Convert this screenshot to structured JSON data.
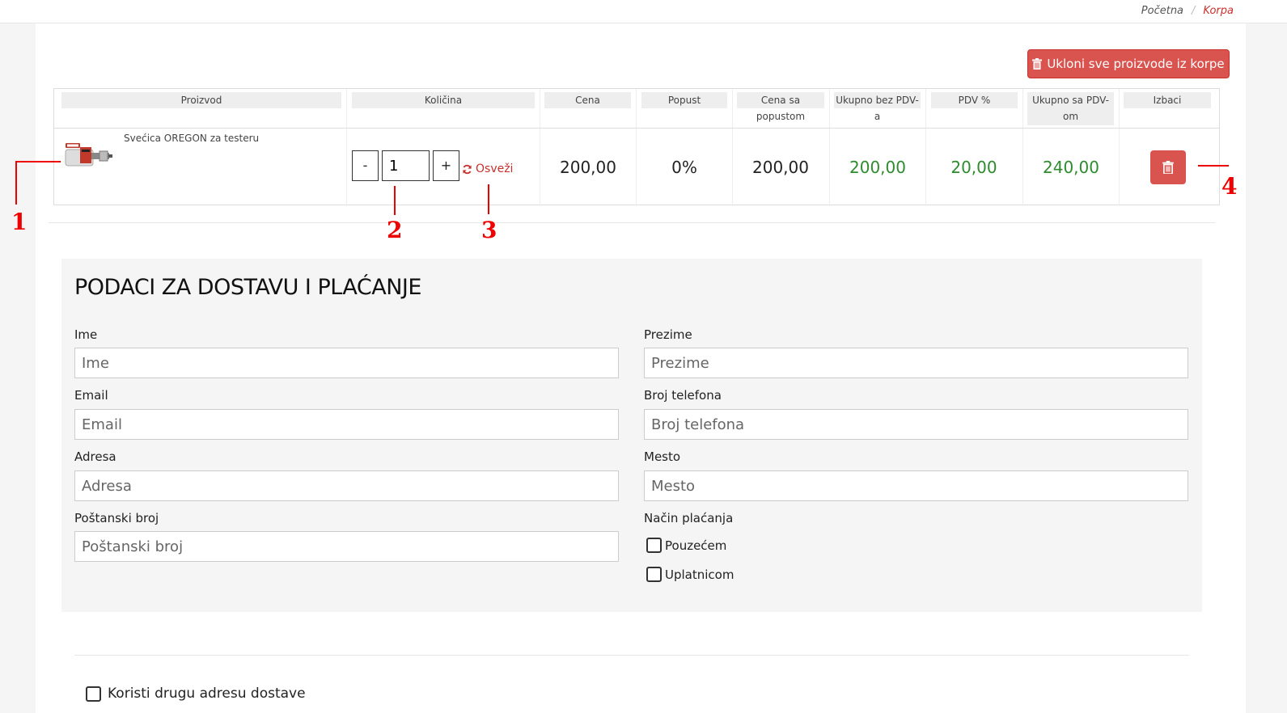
{
  "breadcrumb": {
    "home": "Početna",
    "separator": "/",
    "current": "Korpa"
  },
  "cart": {
    "clear_button_label": "Ukloni sve proizvode iz korpe",
    "headers": {
      "product": "Proizvod",
      "quantity": "Količina",
      "price": "Cena",
      "discount": "Popust",
      "discounted_price": "Cena sa popustom",
      "total_without_vat": "Ukupno bez PDV-a",
      "vat_percent": "PDV %",
      "total_with_vat_line1": "Ukupno sa PDV-",
      "total_with_vat_line2": "om",
      "remove": "Izbaci"
    },
    "items": [
      {
        "name": "Svećica OREGON za testeru",
        "quantity": "1",
        "minus": "-",
        "plus": "+",
        "refresh": "Osveži",
        "price": "200,00",
        "discount": "0%",
        "discounted_price": "200,00",
        "total_without_vat": "200,00",
        "vat": "20,00",
        "total_with_vat": "240,00"
      }
    ]
  },
  "form": {
    "title": "PODACI ZA DOSTAVU I PLAĆANJE",
    "first_name": {
      "label": "Ime",
      "placeholder": "Ime"
    },
    "last_name": {
      "label": "Prezime",
      "placeholder": "Prezime"
    },
    "email": {
      "label": "Email",
      "placeholder": "Email"
    },
    "phone": {
      "label": "Broj telefona",
      "placeholder": "Broj telefona"
    },
    "address": {
      "label": "Adresa",
      "placeholder": "Adresa"
    },
    "city": {
      "label": "Mesto",
      "placeholder": "Mesto"
    },
    "postal": {
      "label": "Poštanski broj",
      "placeholder": "Poštanski broj"
    },
    "payment": {
      "label": "Način plaćanja",
      "options": [
        "Pouzećem",
        "Uplatnicom"
      ]
    },
    "alt_address": "Koristi drugu adresu dostave"
  },
  "annotations": [
    "1",
    "2",
    "3",
    "4"
  ],
  "colors": {
    "accent": "#d9534f",
    "green": "#2e8b2e",
    "annotation": "#e00000"
  }
}
